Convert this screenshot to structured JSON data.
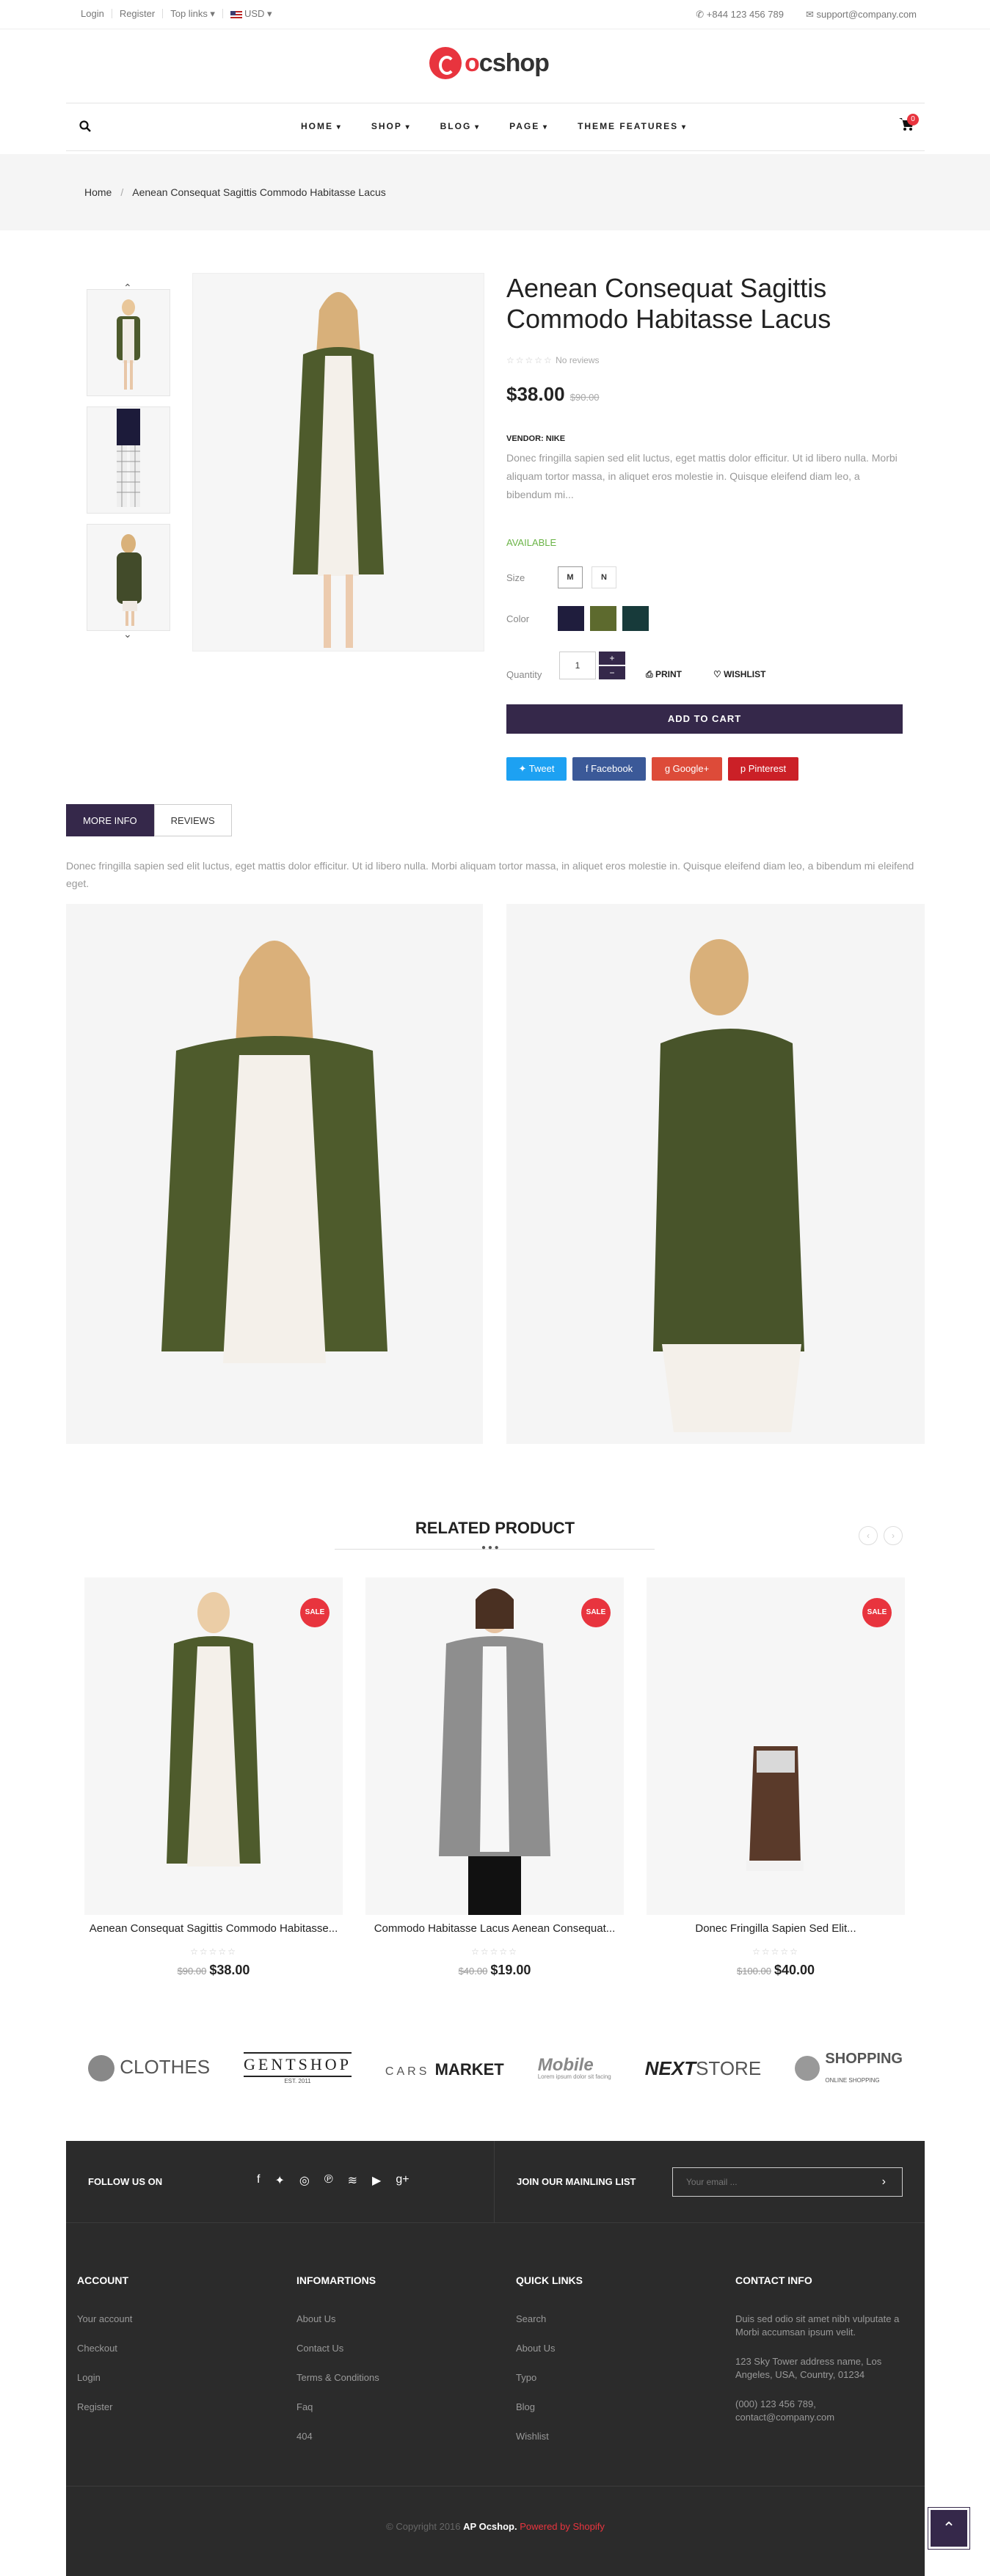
{
  "topbar": {
    "links": [
      "Login",
      "Register",
      "Top links",
      "USD"
    ],
    "phone": "+844 123 456 789",
    "email": "support@company.com"
  },
  "logo": {
    "text_o": "o",
    "text_rest": "cshop"
  },
  "nav": {
    "items": [
      "HOME",
      "SHOP",
      "BLOG",
      "PAGE",
      "THEME FEATURES"
    ],
    "cart_count": "0"
  },
  "breadcrumb": {
    "home": "Home",
    "sep": "/",
    "current": "Aenean Consequat Sagittis Commodo Habitasse Lacus"
  },
  "product": {
    "title": "Aenean Consequat Sagittis Commodo Habitasse Lacus",
    "stars": "☆☆☆☆☆",
    "reviews": "No reviews",
    "price": "$38.00",
    "old_price": "$90.00",
    "vendor": "VENDOR: NIKE",
    "description": "Donec fringilla sapien sed elit luctus, eget mattis dolor efficitur. Ut id libero nulla. Morbi aliquam tortor massa, in aliquet eros molestie in. Quisque eleifend diam leo, a bibendum mi...",
    "availability": "AVAILABLE",
    "size_label": "Size",
    "sizes": [
      "M",
      "N"
    ],
    "color_label": "Color",
    "colors": [
      "#1f1d3d",
      "#5d6a2e",
      "#173a3a"
    ],
    "quantity_label": "Quantity",
    "quantity": "1",
    "print": "PRINT",
    "wishlist": "WISHLIST",
    "add_to_cart": "ADD TO CART",
    "share": [
      {
        "label": "Tweet",
        "color": "#1da1f2"
      },
      {
        "label": "Facebook",
        "color": "#3b5998"
      },
      {
        "label": "Google+",
        "color": "#dd4b39"
      },
      {
        "label": "Pinterest",
        "color": "#cb2027"
      }
    ]
  },
  "tabs": [
    "MORE INFO",
    "REVIEWS"
  ],
  "more_info": "Donec fringilla sapien sed elit luctus, eget mattis dolor efficitur. Ut id libero nulla. Morbi aliquam tortor massa, in aliquet eros molestie in. Quisque eleifend diam leo, a bibendum mi eleifend eget.",
  "related": {
    "title": "RELATED PRODUCT",
    "items": [
      {
        "name": "Aenean Consequat Sagittis Commodo Habitasse...",
        "old": "$90.00",
        "price": "$38.00",
        "badge": "SALE"
      },
      {
        "name": "Commodo Habitasse Lacus Aenean Consequat...",
        "old": "$40.00",
        "price": "$19.00",
        "badge": "SALE"
      },
      {
        "name": "Donec Fringilla Sapien Sed Elit...",
        "old": "$100.00",
        "price": "$40.00",
        "badge": "SALE"
      }
    ]
  },
  "brands": [
    "CLOTHES",
    "GENTSHOP",
    "EST. 2011",
    "CARS",
    "MARKET",
    "Mobile",
    "Lorem ipsum dolor sit facing",
    "NEXT",
    "STORE",
    "SHOPPING",
    "ONLINE SHOPPING"
  ],
  "footer": {
    "follow": "FOLLOW US ON",
    "newsletter": "JOIN OUR MAINLING LIST",
    "email_placeholder": "Your email ...",
    "account": {
      "title": "ACCOUNT",
      "links": [
        "Your account",
        "Checkout",
        "Login",
        "Register"
      ]
    },
    "info": {
      "title": "INFOMARTIONS",
      "links": [
        "About Us",
        "Contact Us",
        "Terms & Conditions",
        "Faq",
        "404"
      ]
    },
    "quick": {
      "title": "QUICK LINKS",
      "links": [
        "Search",
        "About Us",
        "Typo",
        "Blog",
        "Wishlist"
      ]
    },
    "contact": {
      "title": "CONTACT INFO",
      "text": "Duis sed odio sit amet nibh vulputate a Morbi accumsan ipsum velit.",
      "address": "123 Sky Tower address name, Los Angeles, USA, Country, 01234",
      "phone": "(000) 123 456 789,",
      "email": "contact@company.com"
    },
    "copyright": "© Copyright 2016",
    "brand": "AP Ocshop.",
    "powered": "Powered by Shopify"
  }
}
